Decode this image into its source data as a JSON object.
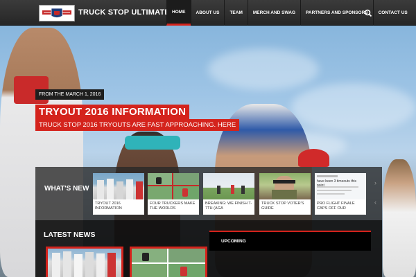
{
  "site": {
    "title": "TRUCK STOP ULTIMATE",
    "logo_icon": "team-shield-logo"
  },
  "nav": {
    "items": [
      {
        "label": "HOME",
        "active": true
      },
      {
        "label": "ABOUT US",
        "active": false
      },
      {
        "label": "TEAM",
        "active": false
      },
      {
        "label": "MERCH AND SWAG",
        "active": false
      },
      {
        "label": "PARTNERS AND SPONSORS",
        "active": false
      },
      {
        "label": "CONTACT US",
        "active": false
      }
    ],
    "search_icon": "search-icon"
  },
  "hero": {
    "kicker": "FROM THE MARCH 1, 2016",
    "headline": "TRYOUT 2016 INFORMATION",
    "subline": "TRUCK STOP 2016 TRYOUTS ARE FAST APPROACHING. HERE"
  },
  "whats_new": {
    "label": "WHAT'S NEW",
    "items": [
      {
        "caption": "TRYOUT 2016 INFORMATION"
      },
      {
        "caption": "FOUR TRUCKERS MAKE THE WORLDS"
      },
      {
        "caption": "BREAKING: WE FINISH T-7TH (AGA"
      },
      {
        "caption": "TRUCK STOP VOTER'S GUIDE"
      },
      {
        "caption": "PRO FLIGHT FINALE CAPS OFF OUR"
      }
    ],
    "tweet_text": "have been 3 timeouts this point"
  },
  "latest": {
    "title": "LATEST NEWS"
  },
  "upcoming": {
    "title": "UPCOMING"
  },
  "colors": {
    "accent": "#d4231c",
    "nav_bg": "#2f2f2f"
  }
}
